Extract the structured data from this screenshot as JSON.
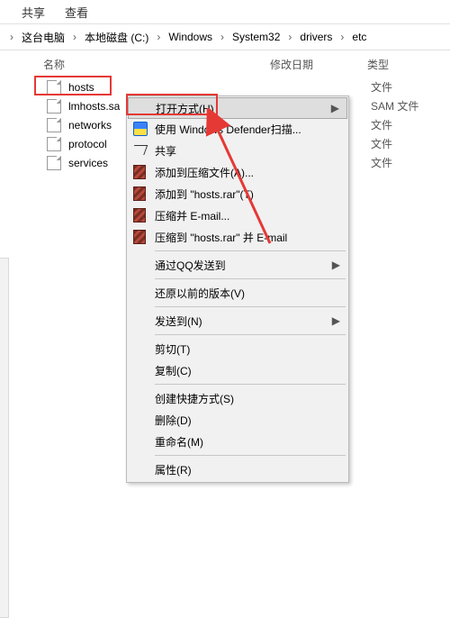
{
  "menu": {
    "share": "共享",
    "view": "查看"
  },
  "breadcrumbs": {
    "items": [
      "这台电脑",
      "本地磁盘 (C:)",
      "Windows",
      "System32",
      "drivers",
      "etc"
    ]
  },
  "columns": {
    "name": "名称",
    "modified": "修改日期",
    "type": "类型"
  },
  "files": [
    {
      "name": "hosts",
      "type": "文件"
    },
    {
      "name": "lmhosts.sa",
      "type": "SAM 文件"
    },
    {
      "name": "networks",
      "type": "文件"
    },
    {
      "name": "protocol",
      "type": "文件"
    },
    {
      "name": "services",
      "type": "文件"
    }
  ],
  "context_menu": {
    "open_with": "打开方式(H)",
    "defender": "使用 Windows Defender扫描...",
    "share": "共享",
    "rar_add": "添加到压缩文件(A)...",
    "rar_addhost": "添加到 \"hosts.rar\"(T)",
    "rar_email": "压缩并 E-mail...",
    "rar_emailto": "压缩到 \"hosts.rar\" 并 E-mail",
    "qq": "通过QQ发送到",
    "restore": "还原以前的版本(V)",
    "sendto": "发送到(N)",
    "cut": "剪切(T)",
    "copy": "复制(C)",
    "shortcut": "创建快捷方式(S)",
    "del": "删除(D)",
    "rename": "重命名(M)",
    "props": "属性(R)"
  },
  "submenu_marker": "▶"
}
